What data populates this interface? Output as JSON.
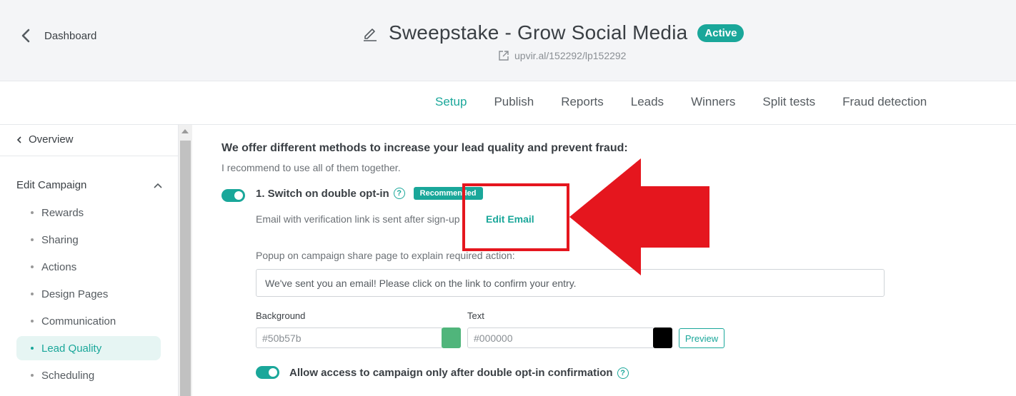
{
  "header": {
    "back_label": "Dashboard",
    "title": "Sweepstake - Grow Social Media",
    "status": "Active",
    "url": "upvir.al/152292/lp152292"
  },
  "tabs": [
    {
      "label": "Setup",
      "active": true
    },
    {
      "label": "Publish"
    },
    {
      "label": "Reports"
    },
    {
      "label": "Leads"
    },
    {
      "label": "Winners"
    },
    {
      "label": "Split tests"
    },
    {
      "label": "Fraud detection"
    }
  ],
  "sidebar": {
    "overview": "Overview",
    "section": "Edit Campaign",
    "items": [
      {
        "label": "Rewards"
      },
      {
        "label": "Sharing"
      },
      {
        "label": "Actions"
      },
      {
        "label": "Design Pages"
      },
      {
        "label": "Communication"
      },
      {
        "label": "Lead Quality",
        "active": true
      },
      {
        "label": "Scheduling"
      }
    ]
  },
  "main": {
    "heading": "We offer different methods to increase your lead quality and prevent fraud:",
    "subheading": "I recommend to use all of them together.",
    "option1": {
      "title": "1. Switch on double opt-in",
      "badge": "Recommended",
      "enabled": true,
      "description": "Email with verification link is sent after sign-up",
      "edit_link": "Edit Email",
      "popup_label": "Popup on campaign share page to explain required action:",
      "popup_value": "We've sent you an email! Please click on the link to confirm your entry.",
      "background_label": "Background",
      "background_value": "#50b57b",
      "text_label": "Text",
      "text_value": "#000000",
      "preview_label": "Preview"
    },
    "allow_access": {
      "label": "Allow access to campaign only after double opt-in confirmation",
      "enabled": true
    },
    "help_glyph": "?"
  },
  "colors": {
    "accent": "#1aa79a",
    "annotation": "#e5161e"
  },
  "icons": [
    "chevron-left-icon",
    "pencil-icon",
    "external-link-icon",
    "chevron-up-icon",
    "help-icon"
  ]
}
